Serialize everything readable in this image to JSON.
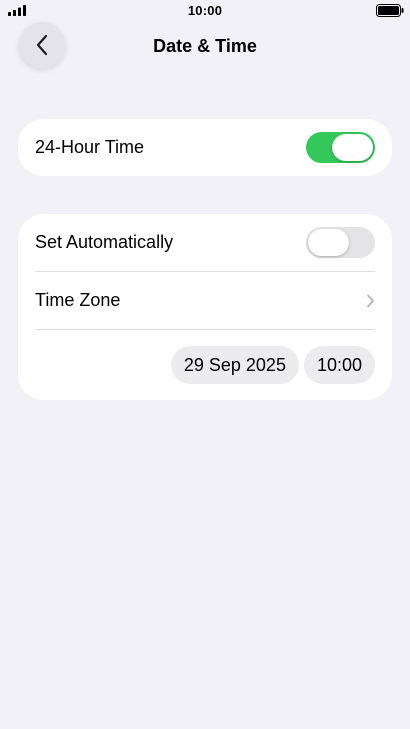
{
  "status_bar": {
    "time": "10:00",
    "icons": [
      "signal-icon",
      "battery-icon"
    ]
  },
  "nav": {
    "back_icon": "chevron-left-icon",
    "title": "Date & Time"
  },
  "settings": {
    "hour24": {
      "label": "24-Hour Time",
      "enabled": true
    },
    "set_automatically": {
      "label": "Set Automatically",
      "enabled": false
    },
    "time_zone": {
      "label": "Time Zone",
      "icon": "chevron-right-icon"
    },
    "date_value": "29 Sep 2025",
    "time_value": "10:00"
  },
  "colors": {
    "toggle_on": "#34c759",
    "toggle_off": "#e4e4e7",
    "background": "#f2f1f7"
  }
}
